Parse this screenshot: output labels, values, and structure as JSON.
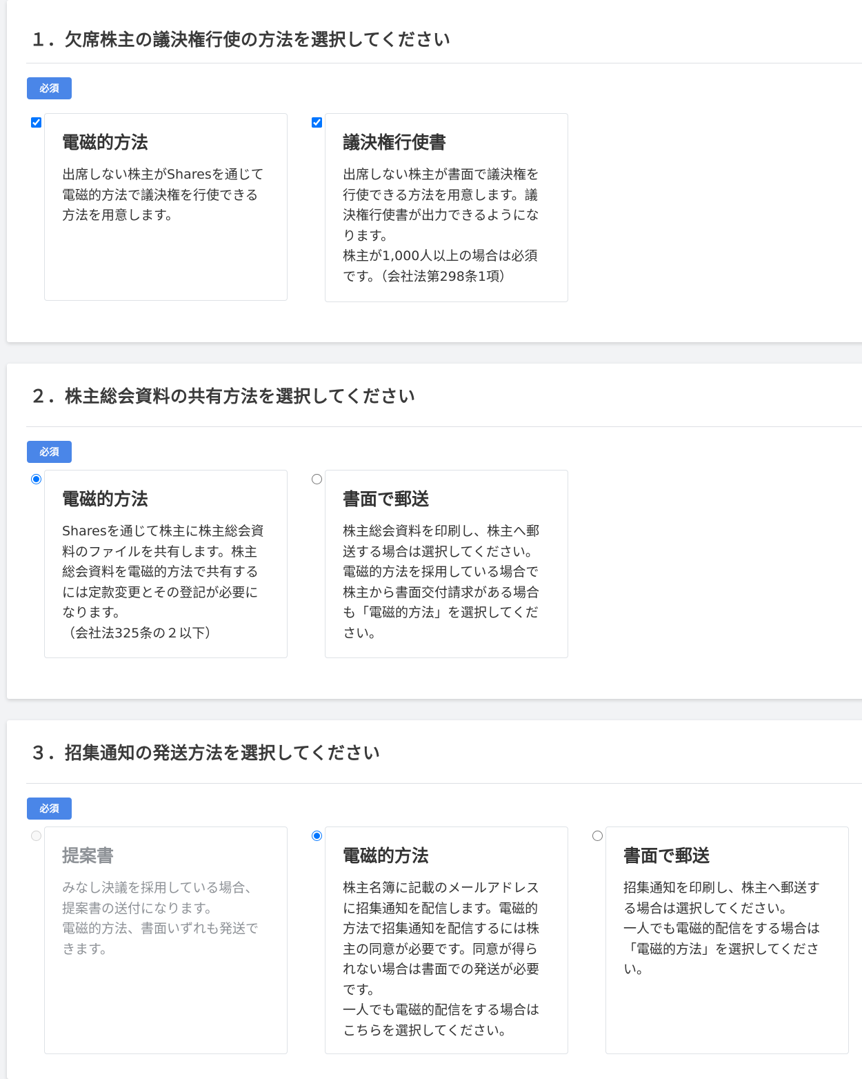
{
  "sections": [
    {
      "title": "１．欠席株主の議決権行使の方法を選択してください",
      "badge": "必須",
      "options": [
        {
          "title": "電磁的方法",
          "desc": "出席しない株主がSharesを通じて\n電磁的方法で議決権を行使できる\n方法を用意します。",
          "checked": true
        },
        {
          "title": "議決権行使書",
          "desc": "出席しない株主が書面で議決権を\n行使できる方法を用意します。議\n決権行使書が出力できるようにな\nります。\n株主が1,000人以上の場合は必須\nです。（会社法第298条1項）",
          "checked": true
        }
      ]
    },
    {
      "title": "２．株主総会資料の共有方法を選択してください",
      "badge": "必須",
      "options": [
        {
          "title": "電磁的方法",
          "desc": "Sharesを通じて株主に株主総会資\n料のファイルを共有します。株主\n総会資料を電磁的方法で共有する\nには定款変更とその登記が必要に\nなります。\n（会社法325条の２以下）",
          "checked": true
        },
        {
          "title": "書面で郵送",
          "desc": "株主総会資料を印刷し、株主へ郵\n送する場合は選択してください。\n電磁的方法を採用している場合で\n株主から書面交付請求がある場合\nも「電磁的方法」を選択してくだ\nさい。",
          "checked": false
        }
      ]
    },
    {
      "title": "３．招集通知の発送方法を選択してください",
      "badge": "必須",
      "options": [
        {
          "title": "提案書",
          "desc": "みなし決議を採用している場合、\n提案書の送付になります。\n電磁的方法、書面いずれも発送で\nきます。",
          "checked": false,
          "disabled": true
        },
        {
          "title": "電磁的方法",
          "desc": "株主名簿に記載のメールアドレス\nに招集通知を配信します。電磁的\n方法で招集通知を配信するには株\n主の同意が必要です。同意が得ら\nれない場合は書面での発送が必要\nです。\n一人でも電磁的配信をする場合は\nこちらを選択してください。",
          "checked": true
        },
        {
          "title": "書面で郵送",
          "desc": "招集通知を印刷し、株主へ郵送す\nる場合は選択してください。\n一人でも電磁的配信をする場合は\n「電磁的方法」を選択してくださ\nい。",
          "checked": false
        }
      ]
    }
  ]
}
